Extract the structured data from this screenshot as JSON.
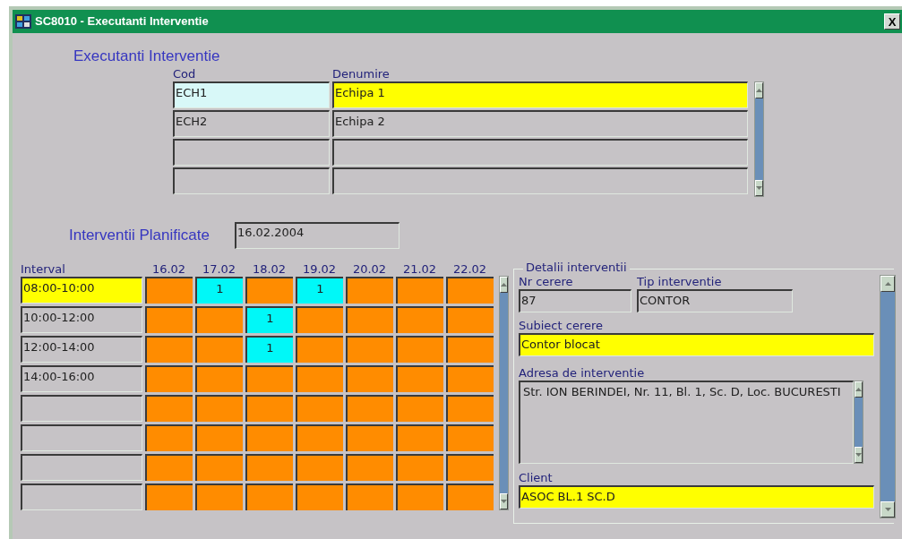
{
  "window": {
    "title": "SC8010 - Executanti Interventie",
    "close": "X"
  },
  "executanti": {
    "heading": "Executanti Interventie",
    "columns": [
      "Cod",
      "Denumire"
    ],
    "rows": [
      {
        "cod": "ECH1",
        "denumire": "Echipa 1",
        "selected": true
      },
      {
        "cod": "ECH2",
        "denumire": "Echipa 2",
        "selected": false
      },
      {
        "selected": false
      },
      {
        "selected": false
      }
    ]
  },
  "planificate": {
    "heading": "Interventii Planificate",
    "date": "16.02.2004",
    "interval_header": "Interval",
    "days": [
      "16.02",
      "17.02",
      "18.02",
      "19.02",
      "20.02",
      "21.02",
      "22.02"
    ],
    "rows": [
      {
        "interval": "08:00-10:00",
        "selected": true,
        "cells": [
          {
            "booked": false
          },
          {
            "booked": true,
            "text": "1"
          },
          {
            "booked": false
          },
          {
            "booked": true,
            "text": "1"
          },
          {
            "booked": false
          },
          {
            "booked": false
          },
          {
            "booked": false
          }
        ]
      },
      {
        "interval": "10:00-12:00",
        "selected": false,
        "cells": [
          {
            "booked": false
          },
          {
            "booked": false
          },
          {
            "booked": true,
            "text": "1"
          },
          {
            "booked": false
          },
          {
            "booked": false
          },
          {
            "booked": false
          },
          {
            "booked": false
          }
        ]
      },
      {
        "interval": "12:00-14:00",
        "selected": false,
        "cells": [
          {
            "booked": false
          },
          {
            "booked": false
          },
          {
            "booked": true,
            "text": "1"
          },
          {
            "booked": false
          },
          {
            "booked": false
          },
          {
            "booked": false
          },
          {
            "booked": false
          }
        ]
      },
      {
        "interval": "14:00-16:00",
        "selected": false,
        "cells": [
          {
            "booked": false
          },
          {
            "booked": false
          },
          {
            "booked": false
          },
          {
            "booked": false
          },
          {
            "booked": false
          },
          {
            "booked": false
          },
          {
            "booked": false
          }
        ]
      },
      {
        "selected": false,
        "cells": [
          {
            "booked": false
          },
          {
            "booked": false
          },
          {
            "booked": false
          },
          {
            "booked": false
          },
          {
            "booked": false
          },
          {
            "booked": false
          },
          {
            "booked": false
          }
        ]
      },
      {
        "selected": false,
        "cells": [
          {
            "booked": false
          },
          {
            "booked": false
          },
          {
            "booked": false
          },
          {
            "booked": false
          },
          {
            "booked": false
          },
          {
            "booked": false
          },
          {
            "booked": false
          }
        ]
      },
      {
        "selected": false,
        "cells": [
          {
            "booked": false
          },
          {
            "booked": false
          },
          {
            "booked": false
          },
          {
            "booked": false
          },
          {
            "booked": false
          },
          {
            "booked": false
          },
          {
            "booked": false
          }
        ]
      },
      {
        "selected": false,
        "cells": [
          {
            "booked": false
          },
          {
            "booked": false
          },
          {
            "booked": false
          },
          {
            "booked": false
          },
          {
            "booked": false
          },
          {
            "booked": false
          },
          {
            "booked": false
          }
        ]
      }
    ]
  },
  "details": {
    "legend": "Detalii interventii",
    "nr_cerere": {
      "label": "Nr cerere",
      "value": "87",
      "required": false
    },
    "tip_interventie": {
      "label": "Tip interventie",
      "value": "CONTOR",
      "required": false
    },
    "subiect_cerere": {
      "label": "Subiect cerere",
      "value": "Contor blocat",
      "required": true
    },
    "adresa": {
      "label": "Adresa de interventie",
      "value": "Str. ION BERINDEI, Nr. 11, Bl. 1, Sc. D, Loc. BUCURESTI"
    },
    "client": {
      "label": "Client",
      "value": "ASOC BL.1 SC.D",
      "required": true
    }
  }
}
